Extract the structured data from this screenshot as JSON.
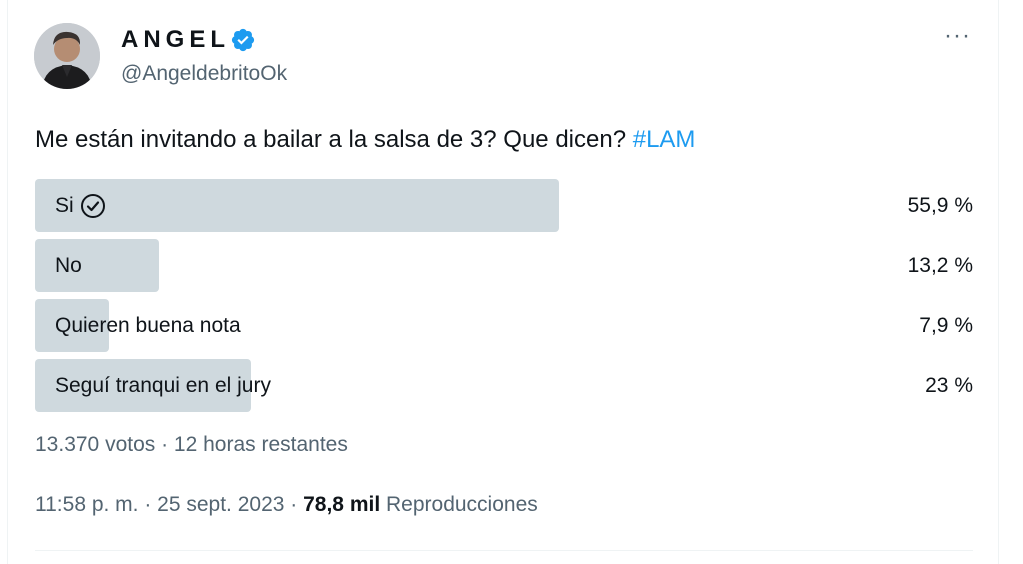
{
  "author": {
    "name": "ANGEL",
    "handle": "@AngeldebritoOk",
    "verified": true,
    "avatar_icon": "profile-photo"
  },
  "more_icon": "more-horizontal-icon",
  "tweet": {
    "text": "Me están invitando a bailar a la salsa de 3? Que dicen? ",
    "hashtag": "#LAM"
  },
  "poll": {
    "options": [
      {
        "label": "Si",
        "percent": "55,9 %",
        "fraction": 0.559,
        "winner": true
      },
      {
        "label": "No",
        "percent": "13,2 %",
        "fraction": 0.132,
        "winner": false
      },
      {
        "label": "Quieren buena nota",
        "percent": "7,9 %",
        "fraction": 0.079,
        "winner": false
      },
      {
        "label": "Seguí tranqui en el jury",
        "percent": "23 %",
        "fraction": 0.23,
        "winner": false
      }
    ],
    "meta": "13.370 votos · 12 horas restantes"
  },
  "footer": {
    "time": "11:58 p. m. · 25 sept. 2023 · ",
    "views": "78,8 mil",
    "views_label": " Reproducciones"
  },
  "colors": {
    "accent": "#1d9bf0",
    "bar": "#cfd9de",
    "secondary_text": "#536471"
  }
}
